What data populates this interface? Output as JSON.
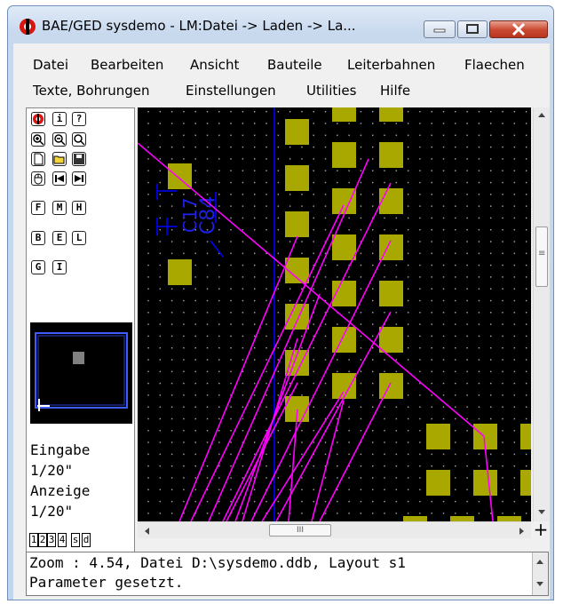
{
  "window": {
    "title": "BAE/GED sysdemo - LM:Datei -> Laden -> La...",
    "app_icon": "bae-logo-icon",
    "controls": [
      "minimize-icon",
      "maximize-icon",
      "close-icon"
    ]
  },
  "menu": {
    "row1": [
      "Datei",
      "Bearbeiten",
      "Ansicht",
      "Bauteile",
      "Leiterbahnen",
      "Flaechen"
    ],
    "row2": [
      "Texte, Bohrungen",
      "Einstellungen",
      "Utilities",
      "Hilfe"
    ]
  },
  "toolbox": {
    "tool_icons": [
      "bae-logo-icon",
      "info-icon",
      "help-icon",
      "zoom-in-icon",
      "zoom-out-icon",
      "zoom-window-icon",
      "new-file-icon",
      "open-folder-icon",
      "save-disk-icon",
      "mouse-icon",
      "arrow-left-icon",
      "arrow-right-icon"
    ],
    "letter_buttons": [
      "F",
      "M",
      "H",
      "B",
      "E",
      "L",
      "G",
      "I"
    ],
    "info": {
      "input_label": "Eingabe",
      "input_value": "1/20\"",
      "display_label": "Anzeige",
      "display_value": "1/20\""
    },
    "layer_buttons": [
      "1",
      "2",
      "3",
      "4",
      "s",
      "d"
    ]
  },
  "canvas": {
    "labels": [
      "C84",
      "C17"
    ],
    "colors": {
      "background": "#000000",
      "pad": "#a8a800",
      "trace": "#ff00ff",
      "silkscreen": "#0000ff",
      "grid": "#b0b0b0"
    }
  },
  "scrollbars": {
    "vertical_grip": "≡",
    "horizontal_grip": "III",
    "corner_label": "+"
  },
  "console": {
    "line1": "Zoom : 4.54, Datei D:\\sysdemo.ddb, Layout s1",
    "line2": "Parameter gesetzt."
  }
}
